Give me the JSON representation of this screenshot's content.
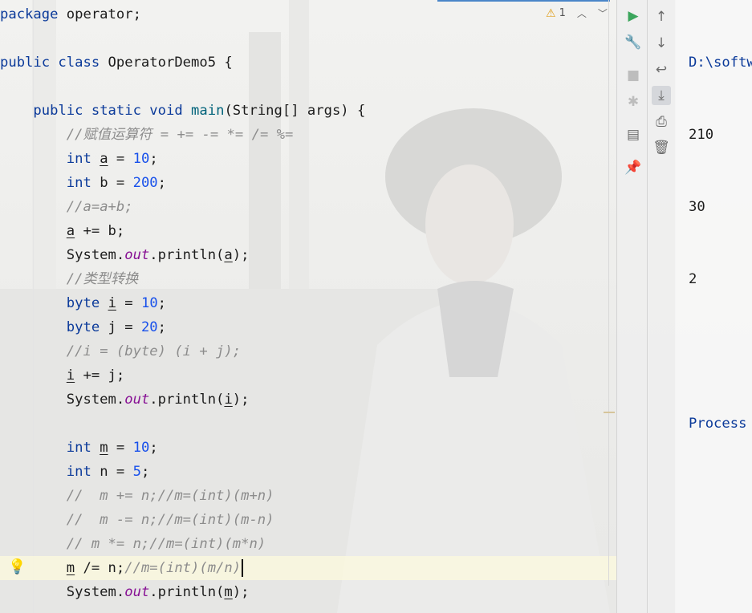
{
  "editor": {
    "lines": [
      [
        {
          "t": "package",
          "c": "kw"
        },
        {
          "t": " operator;",
          "c": ""
        }
      ],
      [],
      [
        {
          "t": "public class",
          "c": "kw"
        },
        {
          "t": " OperatorDemo5 {",
          "c": ""
        }
      ],
      [],
      [
        {
          "t": "    "
        },
        {
          "t": "public static void",
          "c": "kw"
        },
        {
          "t": " "
        },
        {
          "t": "main",
          "c": "fn"
        },
        {
          "t": "(String[] args) {"
        }
      ],
      [
        {
          "t": "        "
        },
        {
          "t": "//赋值运算符 = += -= *= /= %=",
          "c": "cm"
        }
      ],
      [
        {
          "t": "        "
        },
        {
          "t": "int",
          "c": "kw"
        },
        {
          "t": " "
        },
        {
          "t": "a",
          "c": "ul"
        },
        {
          "t": " = "
        },
        {
          "t": "10",
          "c": "num"
        },
        {
          "t": ";"
        }
      ],
      [
        {
          "t": "        "
        },
        {
          "t": "int",
          "c": "kw"
        },
        {
          "t": " b = "
        },
        {
          "t": "200",
          "c": "num"
        },
        {
          "t": ";"
        }
      ],
      [
        {
          "t": "        "
        },
        {
          "t": "//a=a+b;",
          "c": "cm"
        }
      ],
      [
        {
          "t": "        "
        },
        {
          "t": "a",
          "c": "ul"
        },
        {
          "t": " += b;"
        }
      ],
      [
        {
          "t": "        System."
        },
        {
          "t": "out",
          "c": "st"
        },
        {
          "t": ".println("
        },
        {
          "t": "a",
          "c": "ul"
        },
        {
          "t": ");"
        }
      ],
      [
        {
          "t": "        "
        },
        {
          "t": "//类型转换",
          "c": "cm"
        }
      ],
      [
        {
          "t": "        "
        },
        {
          "t": "byte",
          "c": "kw"
        },
        {
          "t": " "
        },
        {
          "t": "i",
          "c": "ul"
        },
        {
          "t": " = "
        },
        {
          "t": "10",
          "c": "num"
        },
        {
          "t": ";"
        }
      ],
      [
        {
          "t": "        "
        },
        {
          "t": "byte",
          "c": "kw"
        },
        {
          "t": " j = "
        },
        {
          "t": "20",
          "c": "num"
        },
        {
          "t": ";"
        }
      ],
      [
        {
          "t": "        "
        },
        {
          "t": "//i = (byte) (i + j);",
          "c": "cm"
        }
      ],
      [
        {
          "t": "        "
        },
        {
          "t": "i",
          "c": "ul"
        },
        {
          "t": " += j;"
        }
      ],
      [
        {
          "t": "        System."
        },
        {
          "t": "out",
          "c": "st"
        },
        {
          "t": ".println("
        },
        {
          "t": "i",
          "c": "ul"
        },
        {
          "t": ");"
        }
      ],
      [],
      [
        {
          "t": "        "
        },
        {
          "t": "int",
          "c": "kw"
        },
        {
          "t": " "
        },
        {
          "t": "m",
          "c": "ul"
        },
        {
          "t": " = "
        },
        {
          "t": "10",
          "c": "num"
        },
        {
          "t": ";"
        }
      ],
      [
        {
          "t": "        "
        },
        {
          "t": "int",
          "c": "kw"
        },
        {
          "t": " n = "
        },
        {
          "t": "5",
          "c": "num"
        },
        {
          "t": ";"
        }
      ],
      [
        {
          "t": "        "
        },
        {
          "t": "//  m += n;//m=(int)(m+n)",
          "c": "cm"
        }
      ],
      [
        {
          "t": "        "
        },
        {
          "t": "//  m -= n;//m=(int)(m-n)",
          "c": "cm"
        }
      ],
      [
        {
          "t": "        "
        },
        {
          "t": "// m *= n;//m=(int)(m*n)",
          "c": "cm"
        }
      ],
      [
        {
          "t": "        "
        },
        {
          "t": "m",
          "c": "ul"
        },
        {
          "t": " /= n;"
        },
        {
          "t": "//m=(int)(m/n)",
          "c": "cm"
        },
        {
          "t": "",
          "c": "caret"
        }
      ],
      [
        {
          "t": "        System."
        },
        {
          "t": "out",
          "c": "st"
        },
        {
          "t": ".println("
        },
        {
          "t": "m",
          "c": "ul"
        },
        {
          "t": ");"
        }
      ]
    ],
    "inspection": {
      "count": "1"
    }
  },
  "toolbar": {
    "icons": [
      "run-icon",
      "wrench-icon",
      "stop-icon",
      "debug-icon",
      "layout-icon",
      "pin-icon"
    ],
    "icons2": [
      "up-arrow-icon",
      "down-arrow-icon",
      "soft-wrap-icon",
      "scroll-to-end-icon",
      "print-icon",
      "trash-icon"
    ]
  },
  "console": {
    "lines": [
      "D:\\softw",
      "210",
      "30",
      "2",
      "",
      "Process"
    ]
  }
}
